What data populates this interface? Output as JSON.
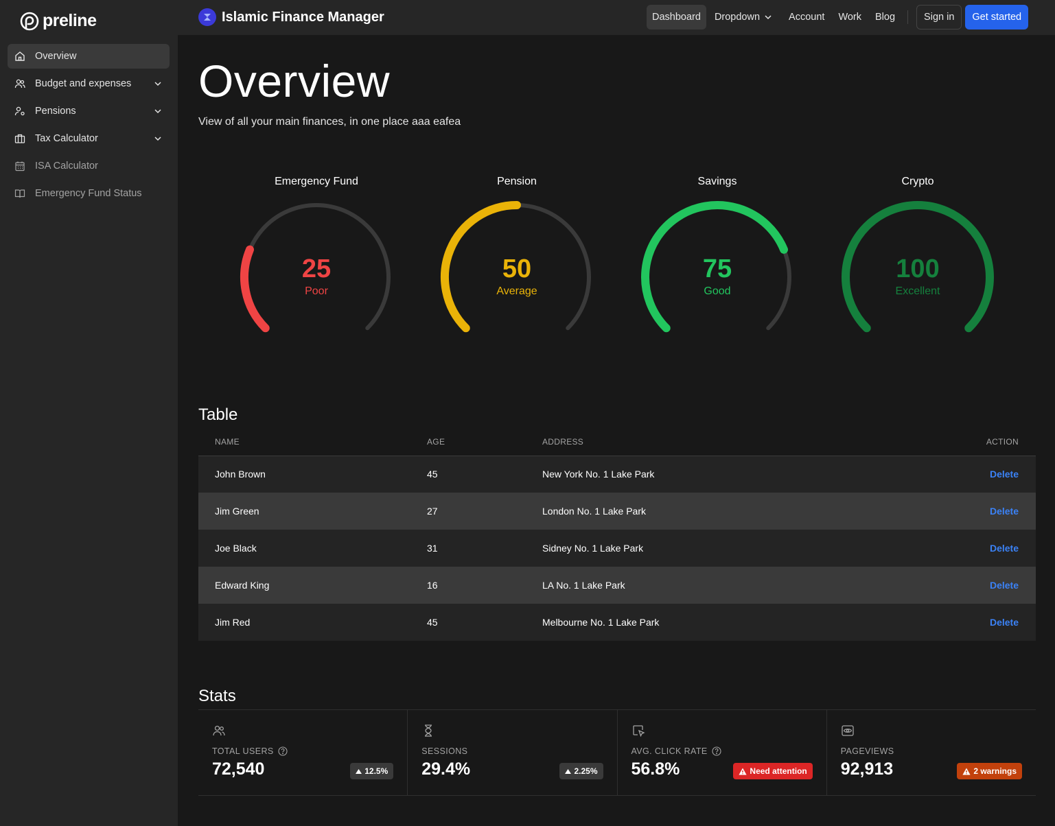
{
  "sidebar": {
    "logo": "preline",
    "items": [
      {
        "label": "Overview"
      },
      {
        "label": "Budget and expenses"
      },
      {
        "label": "Pensions"
      },
      {
        "label": "Tax Calculator"
      },
      {
        "label": "ISA Calculator"
      },
      {
        "label": "Emergency Fund Status"
      }
    ]
  },
  "header": {
    "brand": "Islamic Finance Manager",
    "nav": [
      "Dashboard",
      "Dropdown",
      "Account",
      "Work",
      "Blog"
    ],
    "sign_in": "Sign in",
    "get_started": "Get started"
  },
  "page": {
    "title": "Overview",
    "subtitle": "View of all your main finances, in one place aaa eafea"
  },
  "gauges": [
    {
      "title": "Emergency Fund",
      "value": "25",
      "label": "Poor",
      "color": "#ef4444",
      "percent": 25
    },
    {
      "title": "Pension",
      "value": "50",
      "label": "Average",
      "color": "#eab308",
      "percent": 50
    },
    {
      "title": "Savings",
      "value": "75",
      "label": "Good",
      "color": "#22c55e",
      "percent": 75
    },
    {
      "title": "Crypto",
      "value": "100",
      "label": "Excellent",
      "color": "#15803d",
      "percent": 100
    }
  ],
  "table": {
    "title": "Table",
    "headers": [
      "Name",
      "Age",
      "Address",
      "Action"
    ],
    "rows": [
      {
        "name": "John Brown",
        "age": "45",
        "address": "New York No. 1 Lake Park",
        "action": "Delete"
      },
      {
        "name": "Jim Green",
        "age": "27",
        "address": "London No. 1 Lake Park",
        "action": "Delete"
      },
      {
        "name": "Joe Black",
        "age": "31",
        "address": "Sidney No. 1 Lake Park",
        "action": "Delete"
      },
      {
        "name": "Edward King",
        "age": "16",
        "address": "LA No. 1 Lake Park",
        "action": "Delete"
      },
      {
        "name": "Jim Red",
        "age": "45",
        "address": "Melbourne No. 1 Lake Park",
        "action": "Delete"
      }
    ]
  },
  "stats": {
    "title": "Stats",
    "cards": [
      {
        "label": "Total users",
        "value": "72,540",
        "badge": "12.5%",
        "icon": "users-icon"
      },
      {
        "label": "Sessions",
        "value": "29.4%",
        "badge": "2.25%",
        "icon": "hourglass-icon"
      },
      {
        "label": "Avg. Click Rate",
        "value": "56.8%",
        "badge": "Need attention",
        "icon": "cursor-click-icon"
      },
      {
        "label": "Pageviews",
        "value": "92,913",
        "badge": "2 warnings",
        "icon": "eye-icon"
      }
    ]
  }
}
